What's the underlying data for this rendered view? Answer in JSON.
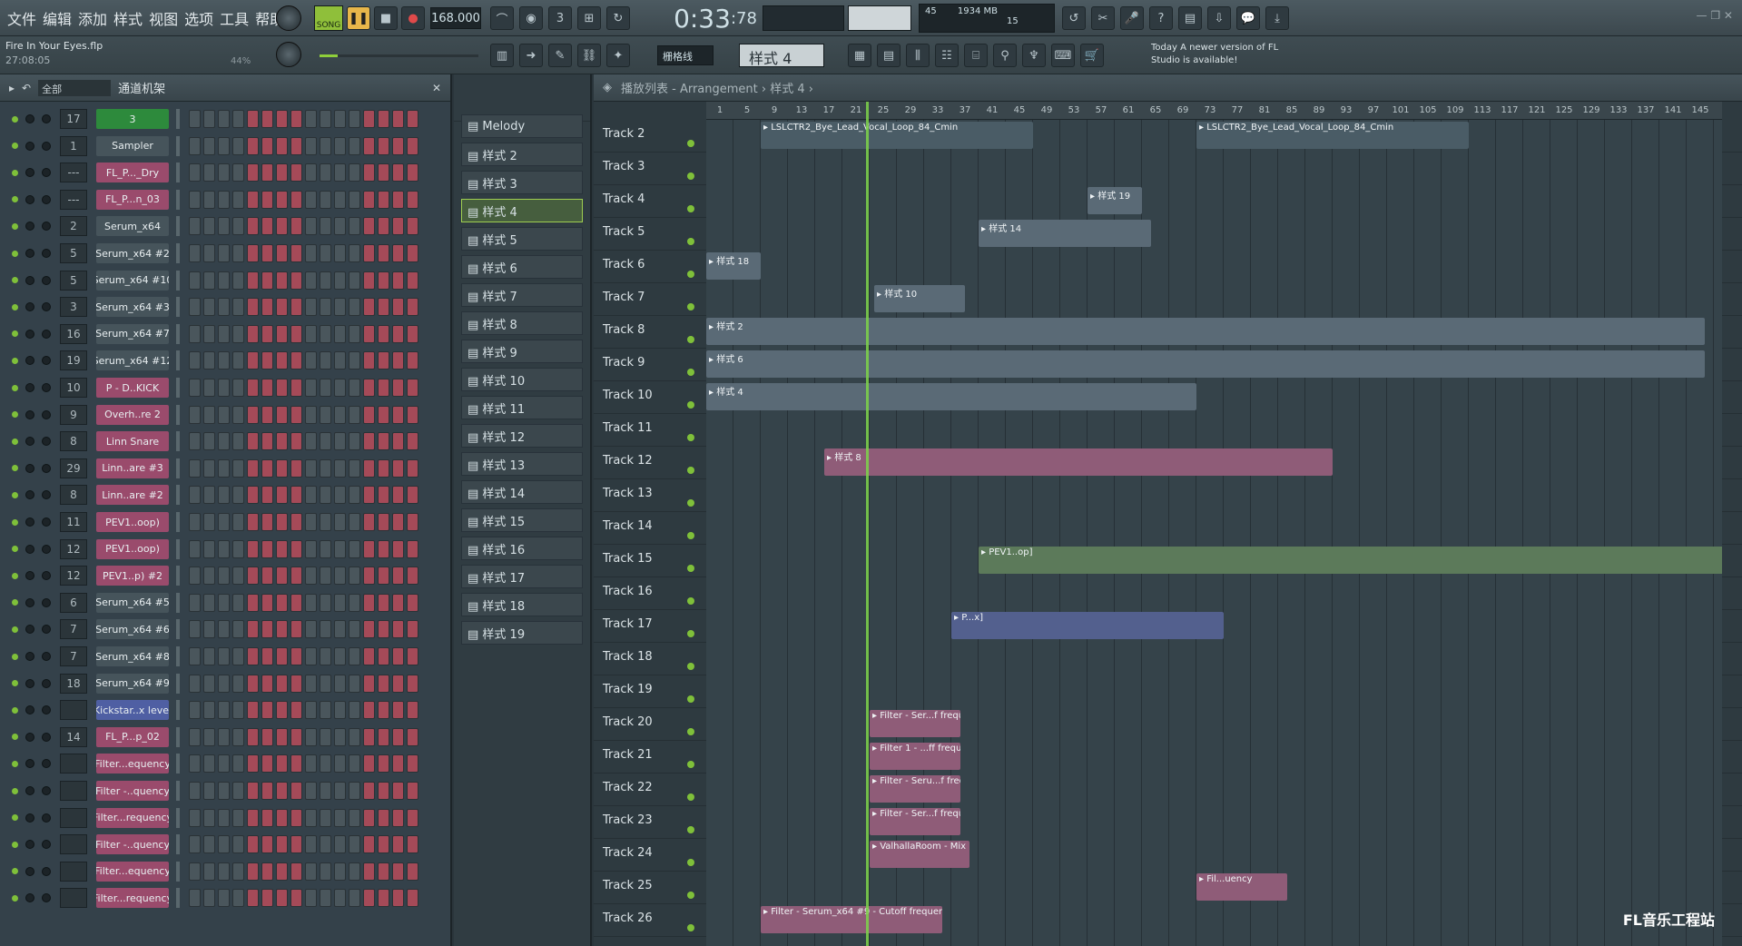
{
  "menu": [
    "文件",
    "编辑",
    "添加",
    "样式",
    "视图",
    "选项",
    "工具",
    "帮助"
  ],
  "transport": {
    "mode": "SONG",
    "tempo": "168.000",
    "time": "0:33",
    "time_ms": ":78",
    "time_label": "M:S:CS",
    "cpu": "45",
    "mem": "1934 MB",
    "poly": "15"
  },
  "project": {
    "file": "Fire In Your Eyes.flp",
    "duration": "27:08:05",
    "zoom": "44%"
  },
  "snap": "栅格线",
  "pattern_selector": "样式 4",
  "news": {
    "line1": "Today  A newer version of FL",
    "line2": "Studio is available!"
  },
  "channel_rack": {
    "filter": "全部",
    "title": "通道机架",
    "channels": [
      {
        "num": "17",
        "name": "3",
        "type": "gr"
      },
      {
        "num": "1",
        "name": "Sampler",
        "type": "g"
      },
      {
        "num": "---",
        "name": "FL_P..._Dry",
        "type": "p"
      },
      {
        "num": "---",
        "name": "FL_P...n_03",
        "type": "p"
      },
      {
        "num": "2",
        "name": "Serum_x64",
        "type": "g"
      },
      {
        "num": "5",
        "name": "Serum_x64 #2",
        "type": "g"
      },
      {
        "num": "5",
        "name": "Serum_x64 #10",
        "type": "g"
      },
      {
        "num": "3",
        "name": "Serum_x64 #3",
        "type": "g"
      },
      {
        "num": "16",
        "name": "Serum_x64 #7",
        "type": "g"
      },
      {
        "num": "19",
        "name": "Serum_x64 #12",
        "type": "g"
      },
      {
        "num": "10",
        "name": "P - D..KICK",
        "type": "p"
      },
      {
        "num": "9",
        "name": "Overh..re 2",
        "type": "p"
      },
      {
        "num": "8",
        "name": "Linn Snare",
        "type": "p"
      },
      {
        "num": "29",
        "name": "Linn..are #3",
        "type": "p"
      },
      {
        "num": "8",
        "name": "Linn..are #2",
        "type": "p"
      },
      {
        "num": "11",
        "name": "PEV1..oop)",
        "type": "p"
      },
      {
        "num": "12",
        "name": "PEV1..oop)",
        "type": "p"
      },
      {
        "num": "12",
        "name": "PEV1..p) #2",
        "type": "p"
      },
      {
        "num": "6",
        "name": "Serum_x64 #5",
        "type": "g"
      },
      {
        "num": "7",
        "name": "Serum_x64 #6",
        "type": "g"
      },
      {
        "num": "7",
        "name": "Serum_x64 #8",
        "type": "g"
      },
      {
        "num": "18",
        "name": "Serum_x64 #9",
        "type": "g"
      },
      {
        "num": "",
        "name": "Kickstar..x level",
        "type": "bl"
      },
      {
        "num": "14",
        "name": "FL_P...p_02",
        "type": "p"
      },
      {
        "num": "",
        "name": "Filter...equency",
        "type": "p"
      },
      {
        "num": "",
        "name": "Filter -..quency",
        "type": "p"
      },
      {
        "num": "",
        "name": "Filter...requency",
        "type": "p"
      },
      {
        "num": "",
        "name": "Filter -..quency",
        "type": "p"
      },
      {
        "num": "",
        "name": "Filter...equency",
        "type": "p"
      },
      {
        "num": "",
        "name": "Filter...requency",
        "type": "p"
      }
    ]
  },
  "patterns": [
    "Melody",
    "样式 2",
    "样式 3",
    "样式 4",
    "样式 5",
    "样式 6",
    "样式 7",
    "样式 8",
    "样式 9",
    "样式 10",
    "样式 11",
    "样式 12",
    "样式 13",
    "样式 14",
    "样式 15",
    "样式 16",
    "样式 17",
    "样式 18",
    "样式 19"
  ],
  "playlist": {
    "breadcrumb": "播放列表 - Arrangement › 样式 4 ›",
    "ruler": [
      "1",
      "5",
      "9",
      "13",
      "17",
      "21",
      "25",
      "29",
      "33",
      "37",
      "41",
      "45",
      "49",
      "53",
      "57",
      "61",
      "65",
      "69",
      "73",
      "77",
      "81",
      "85",
      "89",
      "93",
      "97",
      "101",
      "105",
      "109",
      "113",
      "117",
      "121",
      "125",
      "129",
      "133",
      "137",
      "141",
      "145"
    ],
    "tracks": [
      "Track 2",
      "Track 3",
      "Track 4",
      "Track 5",
      "Track 6",
      "Track 7",
      "Track 8",
      "Track 9",
      "Track 10",
      "Track 11",
      "Track 12",
      "Track 13",
      "Track 14",
      "Track 15",
      "Track 16",
      "Track 17",
      "Track 18",
      "Track 19",
      "Track 20",
      "Track 21",
      "Track 22",
      "Track 23",
      "Track 24",
      "Track 25",
      "Track 26"
    ],
    "clips": [
      {
        "track": 0,
        "label": "LSLCTR2_Bye_Lead_Vocal_Loop_84_Cmin",
        "kind": "au"
      },
      {
        "track": 0,
        "label": "LSLCTR2_Bye_Lead_Vocal_Loop_84_Cmin",
        "kind": "au"
      },
      {
        "track": 2,
        "label": "样式 19",
        "kind": "a"
      },
      {
        "track": 3,
        "label": "样式 14",
        "kind": "a"
      },
      {
        "track": 4,
        "label": "样式 18",
        "kind": "a"
      },
      {
        "track": 5,
        "label": "样式 10",
        "kind": "a"
      },
      {
        "track": 6,
        "label": "样式 2",
        "kind": "a"
      },
      {
        "track": 7,
        "label": "样式 6",
        "kind": "a"
      },
      {
        "track": 8,
        "label": "样式 4",
        "kind": "a"
      },
      {
        "track": 10,
        "label": "样式 8",
        "kind": "p"
      },
      {
        "track": 13,
        "label": "PEV1..op]",
        "kind": "gn"
      },
      {
        "track": 15,
        "label": "P...x]",
        "kind": "bl"
      },
      {
        "track": 18,
        "label": "Filter - Ser...f frequency",
        "kind": "p"
      },
      {
        "track": 19,
        "label": "Filter 1 - ...ff frequency",
        "kind": "p"
      },
      {
        "track": 20,
        "label": "Filter - Seru...f frequency",
        "kind": "p"
      },
      {
        "track": 21,
        "label": "Filter - Ser...f frequency",
        "kind": "p"
      },
      {
        "track": 22,
        "label": "ValhallaRoom - Mix level",
        "kind": "p"
      },
      {
        "track": 23,
        "label": "Fil...uency",
        "kind": "p"
      },
      {
        "track": 24,
        "label": "Filter - Serum_x64 #9 - Cutoff frequency",
        "kind": "p"
      }
    ]
  },
  "watermark": "FL音乐工程站"
}
